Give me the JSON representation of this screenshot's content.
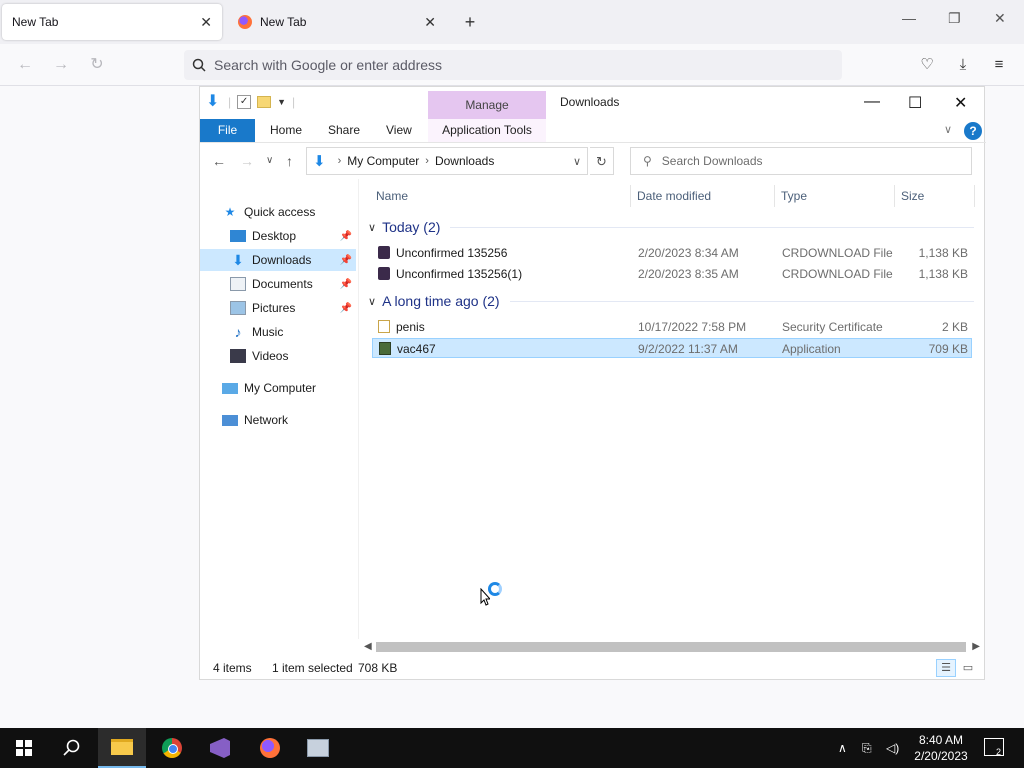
{
  "browser": {
    "tabs": [
      {
        "label": "New Tab"
      },
      {
        "label": "New Tab"
      }
    ],
    "close_glyph": "✕",
    "new_tab_glyph": "+",
    "url_placeholder": "Search with Google or enter address"
  },
  "explorer": {
    "title": "Downloads",
    "manage_label": "Manage",
    "ribbon": {
      "file": "File",
      "home": "Home",
      "share": "Share",
      "view": "View",
      "app_tools": "Application Tools",
      "help": "?"
    },
    "address": {
      "crumbs": [
        "My Computer",
        "Downloads"
      ],
      "search_placeholder": "Search Downloads"
    },
    "nav": {
      "quick_access": "Quick access",
      "items": [
        {
          "label": "Desktop",
          "icon": "desktop-icon"
        },
        {
          "label": "Downloads",
          "icon": "downloads-icon"
        },
        {
          "label": "Documents",
          "icon": "documents-icon"
        },
        {
          "label": "Pictures",
          "icon": "pictures-icon"
        },
        {
          "label": "Music",
          "icon": "music-icon"
        },
        {
          "label": "Videos",
          "icon": "videos-icon"
        }
      ],
      "my_computer": "My Computer",
      "network": "Network"
    },
    "columns": {
      "name": "Name",
      "date": "Date modified",
      "type": "Type",
      "size": "Size"
    },
    "groups": [
      {
        "label": "Today (2)",
        "files": [
          {
            "name": "Unconfirmed 135256",
            "date": "2/20/2023 8:34 AM",
            "type": "CRDOWNLOAD File",
            "size": "1,138 KB",
            "icon": "crdownload-icon"
          },
          {
            "name": "Unconfirmed 135256(1)",
            "date": "2/20/2023 8:35 AM",
            "type": "CRDOWNLOAD File",
            "size": "1,138 KB",
            "icon": "crdownload-icon"
          }
        ]
      },
      {
        "label": "A long time ago (2)",
        "files": [
          {
            "name": "penis",
            "date": "10/17/2022 7:58 PM",
            "type": "Security Certificate",
            "size": "2 KB",
            "icon": "certificate-icon"
          },
          {
            "name": "vac467",
            "date": "9/2/2022 11:37 AM",
            "type": "Application",
            "size": "709 KB",
            "icon": "application-icon",
            "selected": true
          }
        ]
      }
    ],
    "status": {
      "items": "4 items",
      "selected": "1 item selected",
      "size": "708 KB"
    }
  },
  "taskbar": {
    "time": "8:40 AM",
    "date": "2/20/2023",
    "notifications": "2"
  },
  "colors": {
    "accent": "#1979ca",
    "selection": "#cce8ff",
    "manage_tab": "#e5c6f0",
    "taskbar": "#101010"
  }
}
